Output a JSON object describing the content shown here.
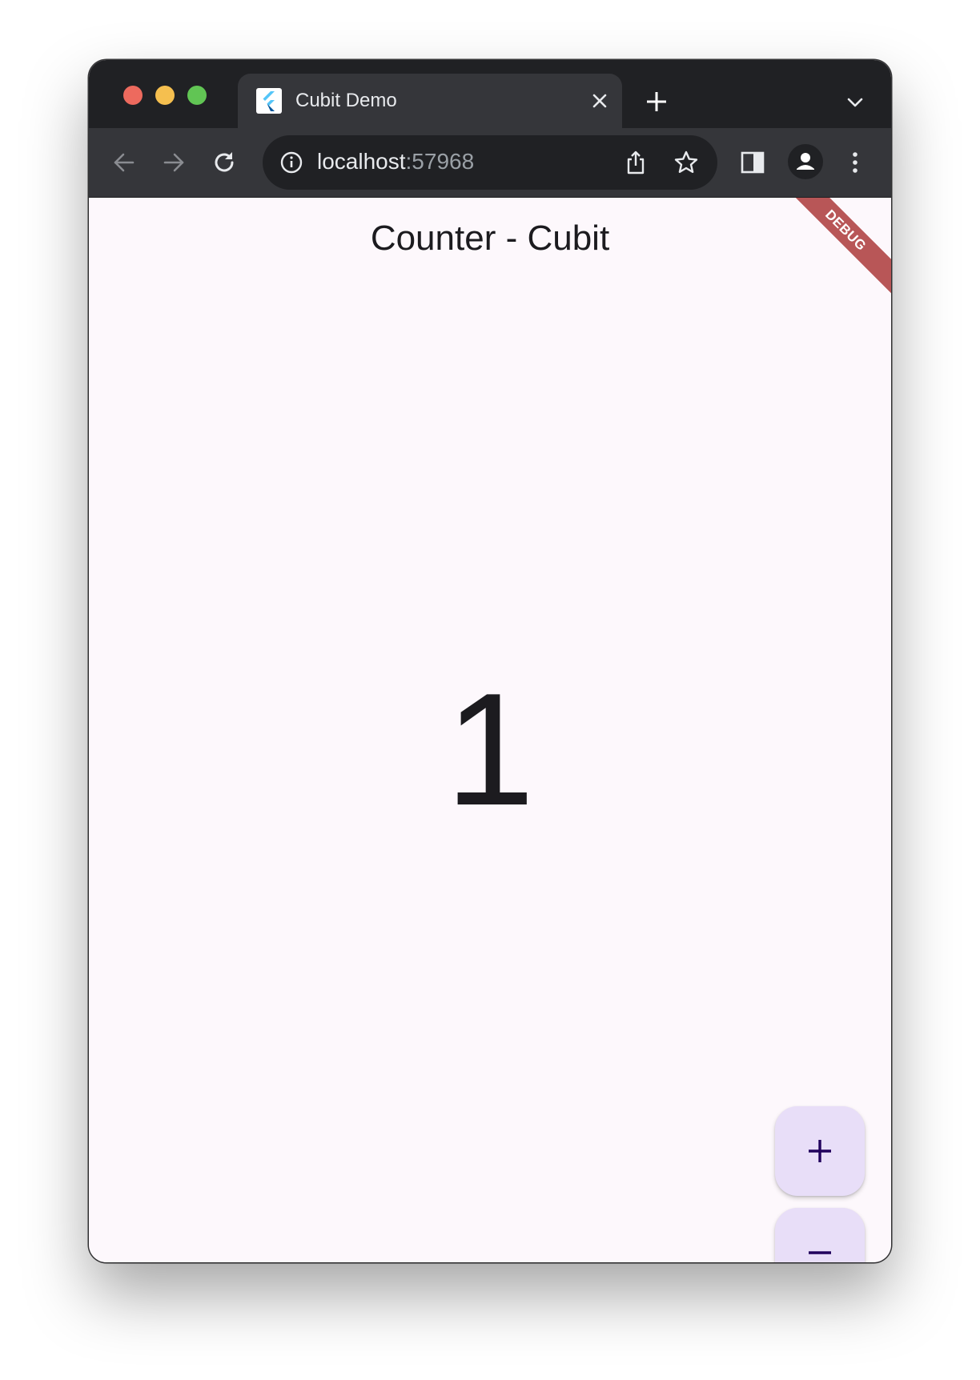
{
  "browser": {
    "tab": {
      "title": "Cubit Demo"
    },
    "address_bar": {
      "host": "localhost",
      "port": ":57968"
    }
  },
  "app": {
    "title": "Counter - Cubit",
    "counter_value": "1",
    "debug_banner": "DEBUG",
    "fab_increment_icon": "plus-icon",
    "fab_decrement_icon": "minus-icon"
  },
  "colors": {
    "fab_background": "#e8def8",
    "fab_icon": "#21005d",
    "page_background": "#fdf8fc",
    "debug_banner": "#a02020"
  }
}
